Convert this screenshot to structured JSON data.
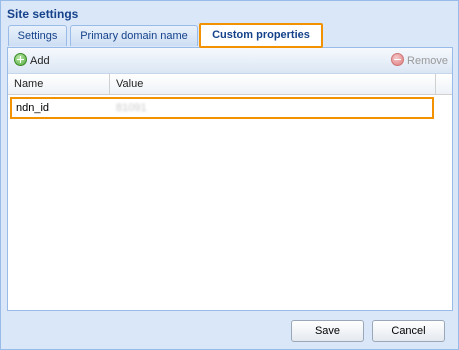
{
  "window": {
    "title": "Site settings"
  },
  "tabs": [
    {
      "label": "Settings"
    },
    {
      "label": "Primary domain name"
    },
    {
      "label": "Custom properties"
    }
  ],
  "toolbar": {
    "add_label": "Add",
    "remove_label": "Remove"
  },
  "grid": {
    "columns": [
      "Name",
      "Value"
    ],
    "rows": [
      {
        "name": "ndn_id",
        "value": "81091"
      }
    ]
  },
  "footer": {
    "save_label": "Save",
    "cancel_label": "Cancel"
  },
  "colors": {
    "highlight": "#f39200",
    "title_text": "#15428b",
    "dialog_bg": "#d9e7f8"
  },
  "icons": {
    "add": "plus-circle-icon",
    "remove": "minus-circle-icon"
  }
}
